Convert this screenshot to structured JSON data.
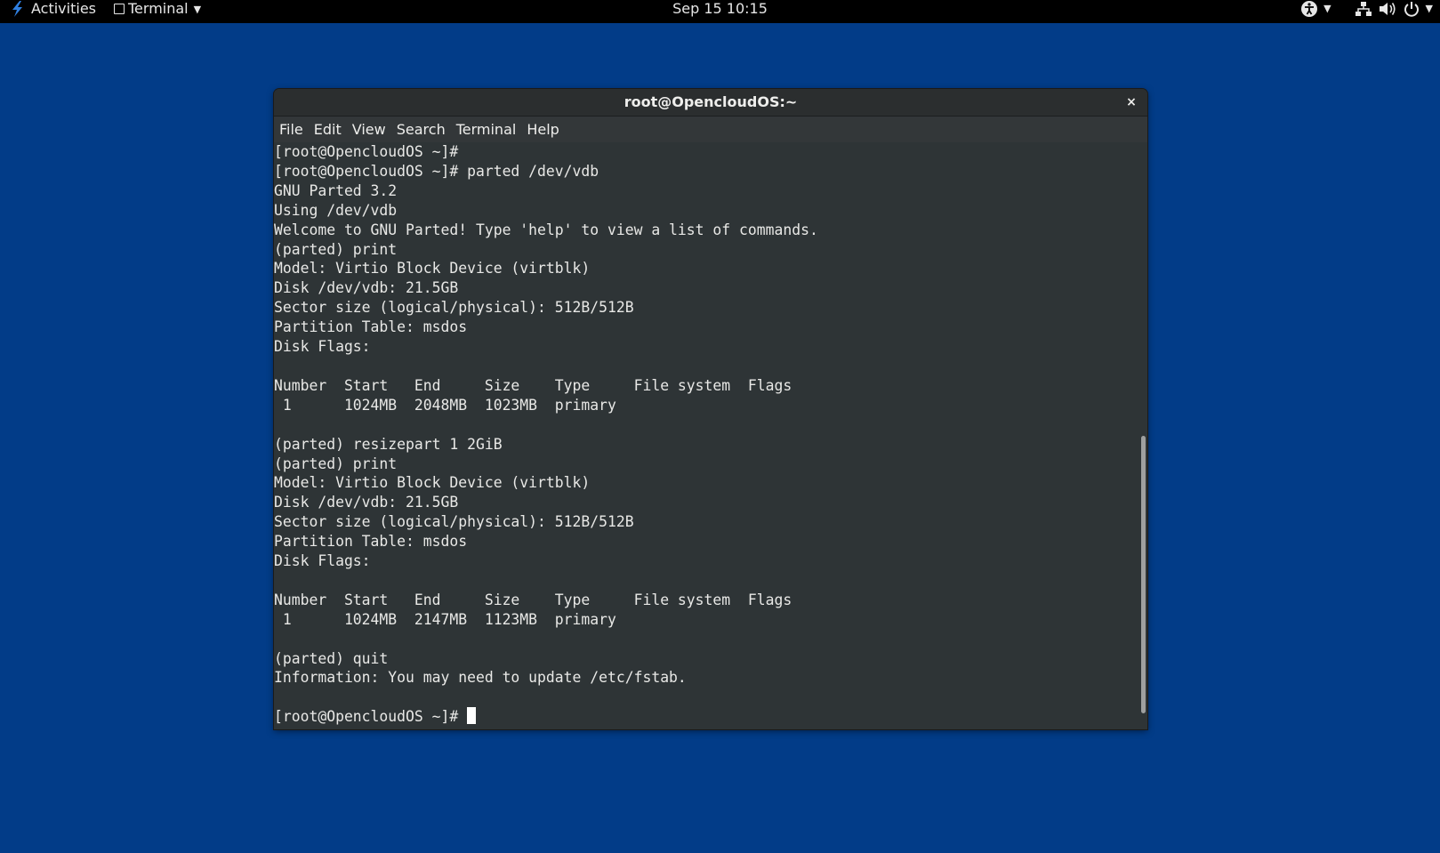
{
  "topbar": {
    "activities": "Activities",
    "app_name": "Terminal",
    "clock": "Sep 15  10:15",
    "icons": [
      "accessibility-icon",
      "network-icon",
      "volume-icon",
      "power-icon"
    ]
  },
  "window": {
    "title": "root@OpencloudOS:~",
    "close_glyph": "×",
    "menu": [
      "File",
      "Edit",
      "View",
      "Search",
      "Terminal",
      "Help"
    ]
  },
  "terminal": {
    "lines": [
      "[root@OpencloudOS ~]#",
      "[root@OpencloudOS ~]# parted /dev/vdb",
      "GNU Parted 3.2",
      "Using /dev/vdb",
      "Welcome to GNU Parted! Type 'help' to view a list of commands.",
      "(parted) print",
      "Model: Virtio Block Device (virtblk)",
      "Disk /dev/vdb: 21.5GB",
      "Sector size (logical/physical): 512B/512B",
      "Partition Table: msdos",
      "Disk Flags:",
      "",
      "Number  Start   End     Size    Type     File system  Flags",
      " 1      1024MB  2048MB  1023MB  primary",
      "",
      "(parted) resizepart 1 2GiB",
      "(parted) print",
      "Model: Virtio Block Device (virtblk)",
      "Disk /dev/vdb: 21.5GB",
      "Sector size (logical/physical): 512B/512B",
      "Partition Table: msdos",
      "Disk Flags:",
      "",
      "Number  Start   End     Size    Type     File system  Flags",
      " 1      1024MB  2147MB  1123MB  primary",
      "",
      "(parted) quit",
      "Information: You may need to update /etc/fstab.",
      ""
    ],
    "prompt": "[root@OpencloudOS ~]# "
  },
  "colors": {
    "desktop_bg": "#023c88",
    "terminal_bg": "#2e3436",
    "terminal_fg": "#e8e8e6",
    "topbar_bg": "#000000"
  }
}
